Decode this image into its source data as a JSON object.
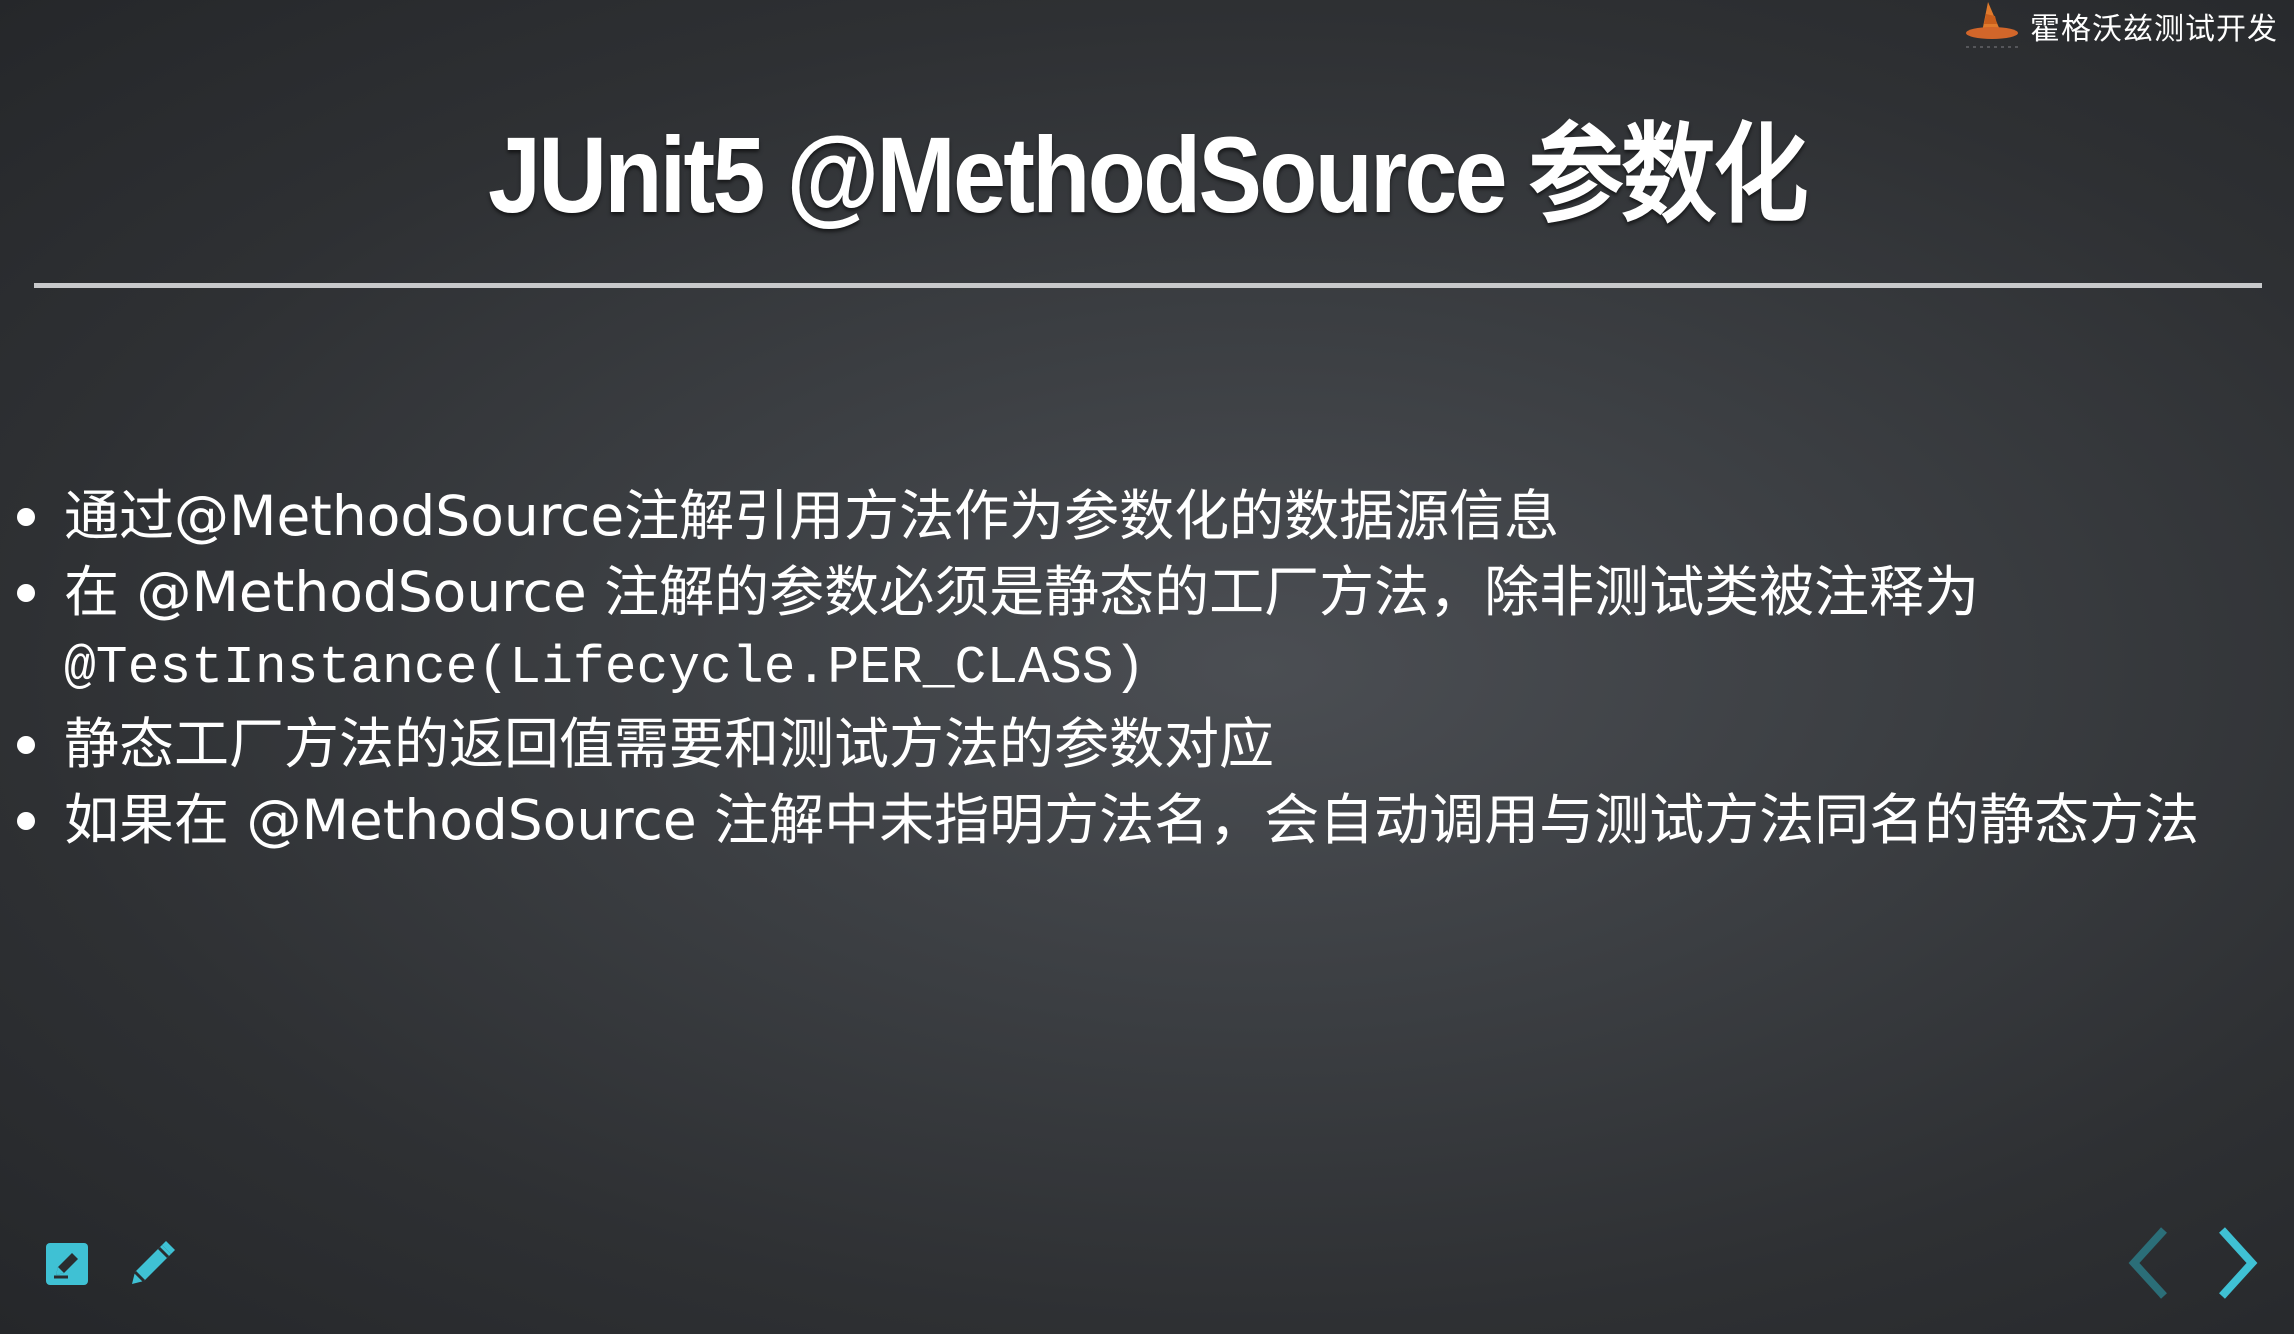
{
  "brand": {
    "name": "霍格沃兹测试开发",
    "logo_icon": "witch-hat-logo-icon"
  },
  "slide": {
    "title": "JUnit5 @MethodSource 参数化",
    "bullets": [
      {
        "text": "通过@MethodSource注解引用方法作为参数化的数据源信息"
      },
      {
        "text": "在 @MethodSource 注解的参数必须是静态的工厂方法，除非测试类被注释为",
        "code": "@TestInstance(Lifecycle.PER_CLASS)"
      },
      {
        "text": "静态工厂方法的返回值需要和测试方法的参数对应"
      },
      {
        "text": "如果在 @MethodSource 注解中未指明方法名，会自动调用与测试方法同名的静态方法"
      }
    ]
  },
  "controls": {
    "edit_icon": "edit-square-icon",
    "annotate_icon": "pencil-icon",
    "prev_icon": "chevron-left-icon",
    "next_icon": "chevron-right-icon",
    "accent_color": "#3fc1d4",
    "disabled_color": "#2b6e78"
  }
}
